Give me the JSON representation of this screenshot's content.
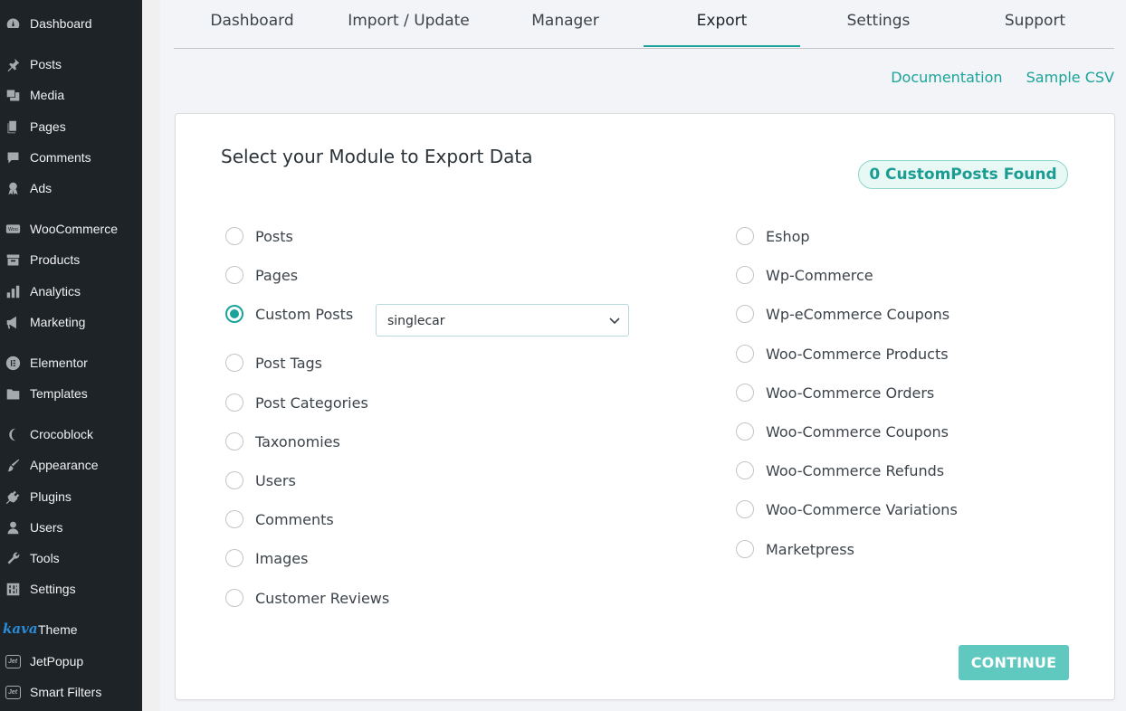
{
  "sidebar": {
    "items": [
      {
        "label": "Dashboard",
        "icon": "dashboard-icon"
      },
      {
        "label": "Posts",
        "icon": "pin-icon"
      },
      {
        "label": "Media",
        "icon": "media-icon"
      },
      {
        "label": "Pages",
        "icon": "pages-icon"
      },
      {
        "label": "Comments",
        "icon": "comment-icon"
      },
      {
        "label": "Ads",
        "icon": "award-icon"
      },
      {
        "label": "WooCommerce",
        "icon": "woo-icon"
      },
      {
        "label": "Products",
        "icon": "archive-icon"
      },
      {
        "label": "Analytics",
        "icon": "bar-chart-icon"
      },
      {
        "label": "Marketing",
        "icon": "megaphone-icon"
      },
      {
        "label": "Elementor",
        "icon": "elementor-icon"
      },
      {
        "label": "Templates",
        "icon": "folder-icon"
      },
      {
        "label": "Crocoblock",
        "icon": "crocoblock-icon"
      },
      {
        "label": "Appearance",
        "icon": "paintbrush-icon"
      },
      {
        "label": "Plugins",
        "icon": "plugin-icon"
      },
      {
        "label": "Users",
        "icon": "user-icon"
      },
      {
        "label": "Tools",
        "icon": "wrench-icon"
      },
      {
        "label": "Settings",
        "icon": "settings-icon"
      },
      {
        "label": "Theme",
        "icon": "kava-logo",
        "logo_text": "kava"
      },
      {
        "label": "JetPopup",
        "icon": "jet-icon",
        "logo_text": "Jet"
      },
      {
        "label": "Smart Filters",
        "icon": "jet-icon",
        "logo_text": "Jet"
      }
    ]
  },
  "tabs": [
    "Dashboard",
    "Import / Update",
    "Manager",
    "Export",
    "Settings",
    "Support"
  ],
  "active_tab": "Export",
  "links": {
    "documentation": "Documentation",
    "sample_csv": "Sample CSV"
  },
  "card": {
    "title": "Select your Module to Export Data",
    "found_badge": "0 CustomPosts Found",
    "left_options": [
      "Posts",
      "Pages",
      "Custom Posts",
      "Post Tags",
      "Post Categories",
      "Taxonomies",
      "Users",
      "Comments",
      "Images",
      "Customer Reviews"
    ],
    "right_options": [
      "Eshop",
      "Wp-Commerce",
      "Wp-eCommerce Coupons",
      "Woo-Commerce Products",
      "Woo-Commerce Orders",
      "Woo-Commerce Coupons",
      "Woo-Commerce Refunds",
      "Woo-Commerce Variations",
      "Marketpress"
    ],
    "selected_option": "Custom Posts",
    "custom_post_select": {
      "value": "singlecar"
    },
    "continue_label": "CONTINUE"
  },
  "colors": {
    "accent": "#1aa39a",
    "button": "#5fc9bf",
    "sidebar": "#1d2327"
  }
}
